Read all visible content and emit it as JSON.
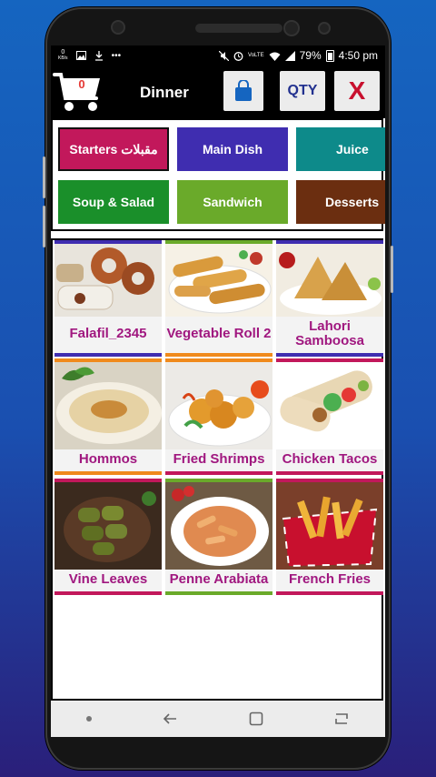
{
  "status": {
    "left_count": "0",
    "left_unit": "KB/s",
    "battery": "79%",
    "time": "4:50 pm",
    "volte": "VoLTE"
  },
  "header": {
    "cart_count": "0",
    "title": "Dinner",
    "qty_label": "QTY",
    "close_label": "X"
  },
  "categories": [
    {
      "label": "Starters مقبلات",
      "color": "#c2185b"
    },
    {
      "label": "Main Dish",
      "color": "#3f2db0"
    },
    {
      "label": "Juice",
      "color": "#0d8a8a"
    },
    {
      "label": "Soup & Salad",
      "color": "#1a8f2a"
    },
    {
      "label": "Sandwich",
      "color": "#6aaa2a"
    },
    {
      "label": "Desserts",
      "color": "#6b2e10"
    }
  ],
  "items": [
    {
      "name": "Falafil_2345",
      "top": "#3f2db0",
      "bottom": "#3f2db0"
    },
    {
      "name": "Vegetable Roll 2",
      "top": "#6aaa2a",
      "bottom": "#f08a1c"
    },
    {
      "name": "Lahori Samboosa",
      "top": "#3f2db0",
      "bottom": "#3f2db0"
    },
    {
      "name": "Hommos",
      "top": "#f08a1c",
      "bottom": "#f08a1c"
    },
    {
      "name": "Fried Shrimps",
      "top": "#f08a1c",
      "bottom": "#c2185b"
    },
    {
      "name": "Chicken Tacos",
      "top": "#c2185b",
      "bottom": "#c2185b"
    },
    {
      "name": "Vine Leaves",
      "top": "#c2185b",
      "bottom": "#c2185b"
    },
    {
      "name": "Penne Arabiata",
      "top": "#6aaa2a",
      "bottom": "#6aaa2a"
    },
    {
      "name": "French Fries",
      "top": "#c2185b",
      "bottom": "#c2185b"
    }
  ]
}
